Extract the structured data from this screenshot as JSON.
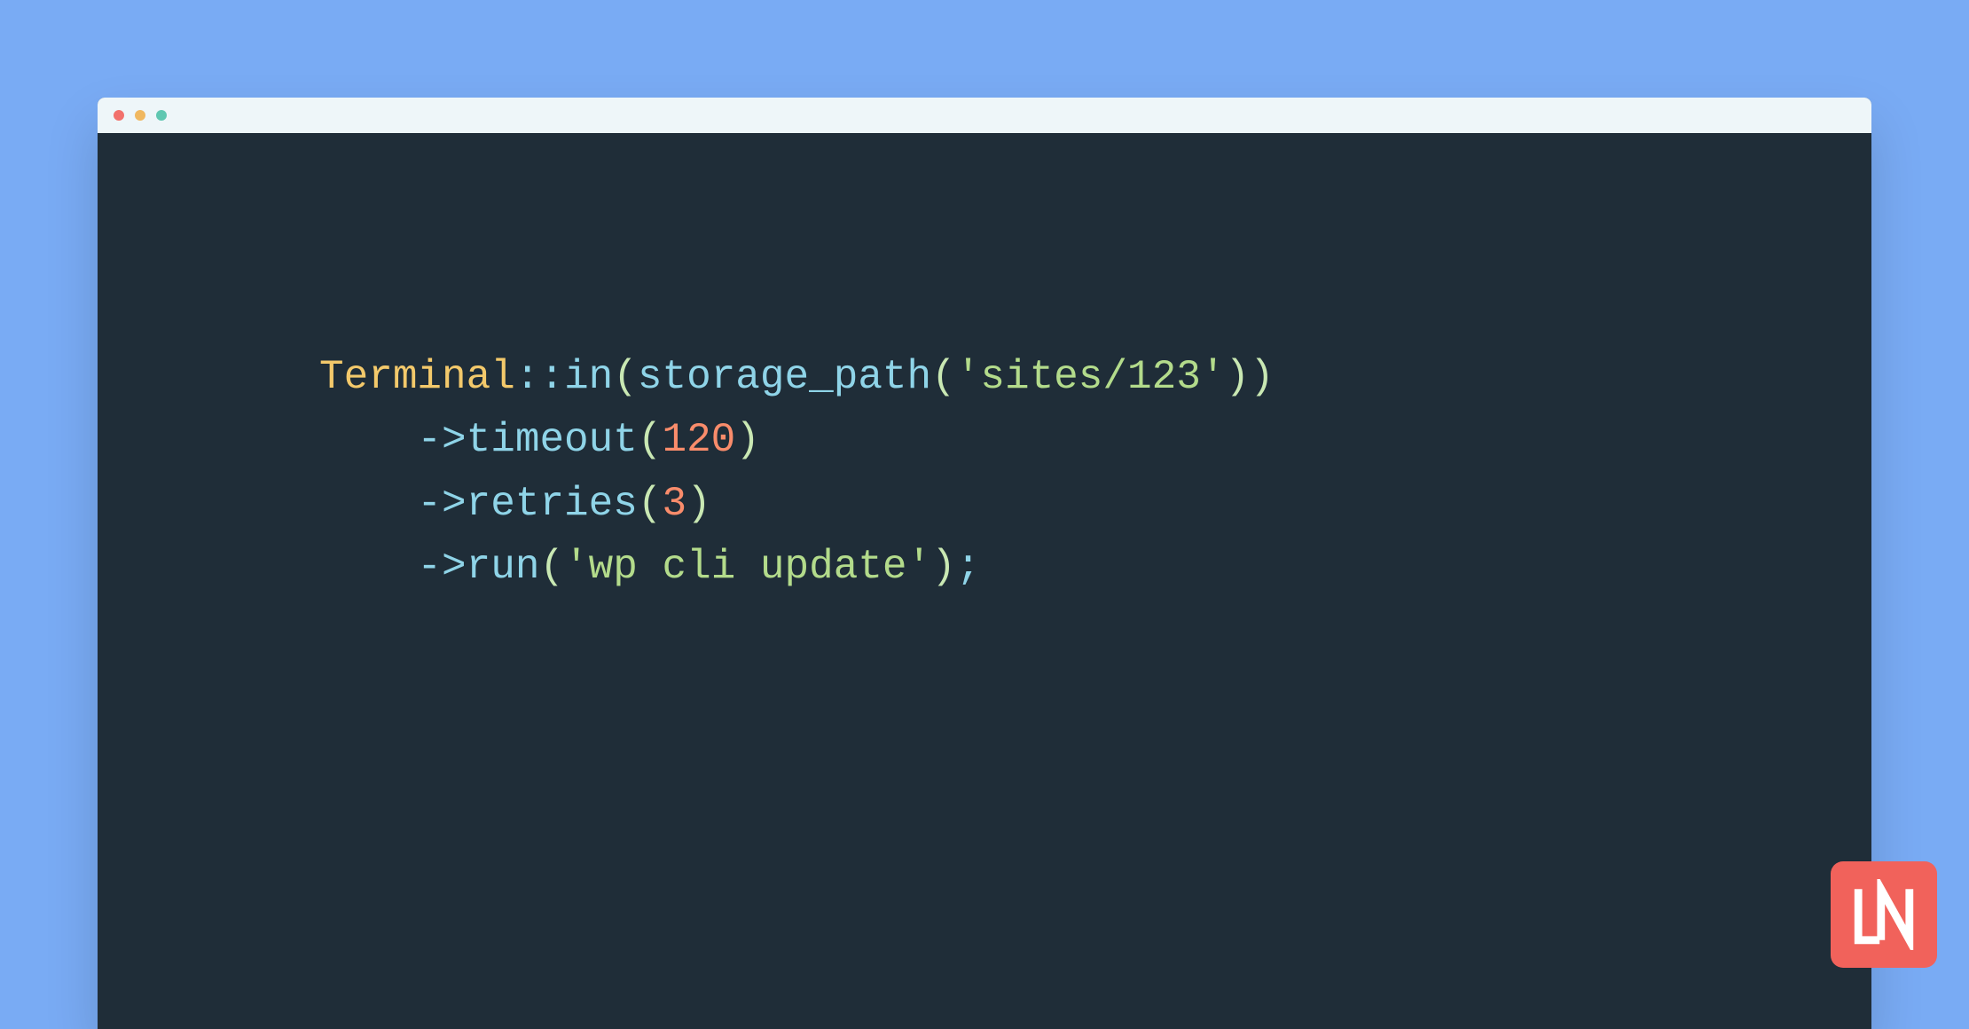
{
  "window": {
    "traffic_lights": [
      "close",
      "minimize",
      "zoom"
    ]
  },
  "code": {
    "lines": [
      {
        "indent": 0,
        "tokens": [
          {
            "t": "class",
            "v": "Terminal"
          },
          {
            "t": "op",
            "v": "::"
          },
          {
            "t": "method",
            "v": "in"
          },
          {
            "t": "paren",
            "v": "("
          },
          {
            "t": "func",
            "v": "storage_path"
          },
          {
            "t": "paren",
            "v": "("
          },
          {
            "t": "string",
            "v": "'sites/123'"
          },
          {
            "t": "paren",
            "v": ")"
          },
          {
            "t": "paren",
            "v": ")"
          }
        ]
      },
      {
        "indent": 1,
        "tokens": [
          {
            "t": "op",
            "v": "->"
          },
          {
            "t": "method",
            "v": "timeout"
          },
          {
            "t": "paren",
            "v": "("
          },
          {
            "t": "number",
            "v": "120"
          },
          {
            "t": "paren",
            "v": ")"
          }
        ]
      },
      {
        "indent": 1,
        "tokens": [
          {
            "t": "op",
            "v": "->"
          },
          {
            "t": "method",
            "v": "retries"
          },
          {
            "t": "paren",
            "v": "("
          },
          {
            "t": "number",
            "v": "3"
          },
          {
            "t": "paren",
            "v": ")"
          }
        ]
      },
      {
        "indent": 1,
        "tokens": [
          {
            "t": "op",
            "v": "->"
          },
          {
            "t": "method",
            "v": "run"
          },
          {
            "t": "paren",
            "v": "("
          },
          {
            "t": "string",
            "v": "'wp cli update'"
          },
          {
            "t": "paren",
            "v": ")"
          },
          {
            "t": "op",
            "v": ";"
          }
        ]
      }
    ]
  },
  "logo": {
    "text": "LN"
  }
}
